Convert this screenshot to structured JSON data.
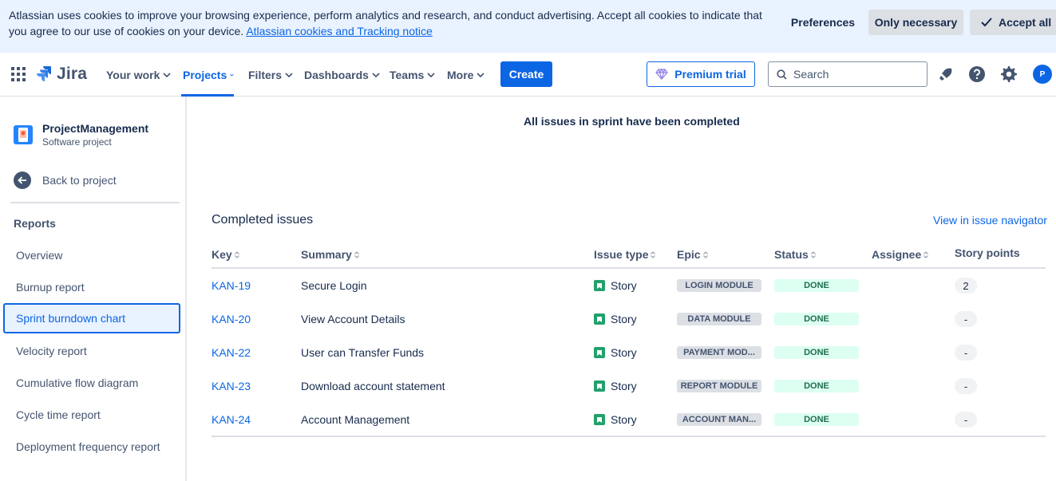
{
  "cookie_banner": {
    "text": "Atlassian uses cookies to improve your browsing experience, perform analytics and research, and conduct advertising. Accept all cookies to indicate that you agree to our use of cookies on your device.",
    "link_text": "Atlassian cookies and Tracking notice",
    "preferences_label": "Preferences",
    "only_necessary_label": "Only necessary",
    "accept_all_label": "Accept all"
  },
  "topnav": {
    "app_name": "Jira",
    "items": [
      {
        "label": "Your work"
      },
      {
        "label": "Projects",
        "active": true
      },
      {
        "label": "Filters"
      },
      {
        "label": "Dashboards"
      },
      {
        "label": "Teams"
      },
      {
        "label": "More"
      }
    ],
    "create_label": "Create",
    "premium_label": "Premium trial",
    "search_placeholder": "Search",
    "avatar_initial": "P",
    "icons": [
      "app-switcher-icon",
      "notifications-icon",
      "help-icon",
      "settings-icon"
    ]
  },
  "sidebar": {
    "project_name": "ProjectManagement",
    "project_type": "Software project",
    "back_label": "Back to project",
    "reports_heading": "Reports",
    "items": [
      {
        "label": "Overview"
      },
      {
        "label": "Burnup report"
      },
      {
        "label": "Sprint burndown chart",
        "selected": true
      },
      {
        "label": "Velocity report"
      },
      {
        "label": "Cumulative flow diagram"
      },
      {
        "label": "Cycle time report"
      },
      {
        "label": "Deployment frequency report"
      }
    ]
  },
  "main": {
    "completed_message": "All issues in sprint have been completed",
    "section_title": "Completed issues",
    "navigator_link": "View in issue navigator",
    "columns": {
      "key": "Key",
      "summary": "Summary",
      "issue_type": "Issue type",
      "epic": "Epic",
      "status": "Status",
      "assignee": "Assignee",
      "story_points": "Story points"
    },
    "rows": [
      {
        "key": "KAN-19",
        "summary": "Secure Login",
        "type": "Story",
        "epic": "LOGIN MODULE",
        "status": "DONE",
        "points": "2"
      },
      {
        "key": "KAN-20",
        "summary": "View Account Details",
        "type": "Story",
        "epic": "DATA MODULE",
        "status": "DONE",
        "points": "-"
      },
      {
        "key": "KAN-22",
        "summary": "User can Transfer Funds",
        "type": "Story",
        "epic": "PAYMENT MOD...",
        "status": "DONE",
        "points": "-"
      },
      {
        "key": "KAN-23",
        "summary": "Download account statement",
        "type": "Story",
        "epic": "REPORT MODULE",
        "status": "DONE",
        "points": "-"
      },
      {
        "key": "KAN-24",
        "summary": "Account Management",
        "type": "Story",
        "epic": "ACCOUNT MAN...",
        "status": "DONE",
        "points": "-"
      }
    ]
  },
  "colors": {
    "brand_blue": "#0c66e4",
    "banner_bg": "#e9f2ff",
    "done_green": "#dcfff1",
    "story_green": "#22a06b"
  }
}
